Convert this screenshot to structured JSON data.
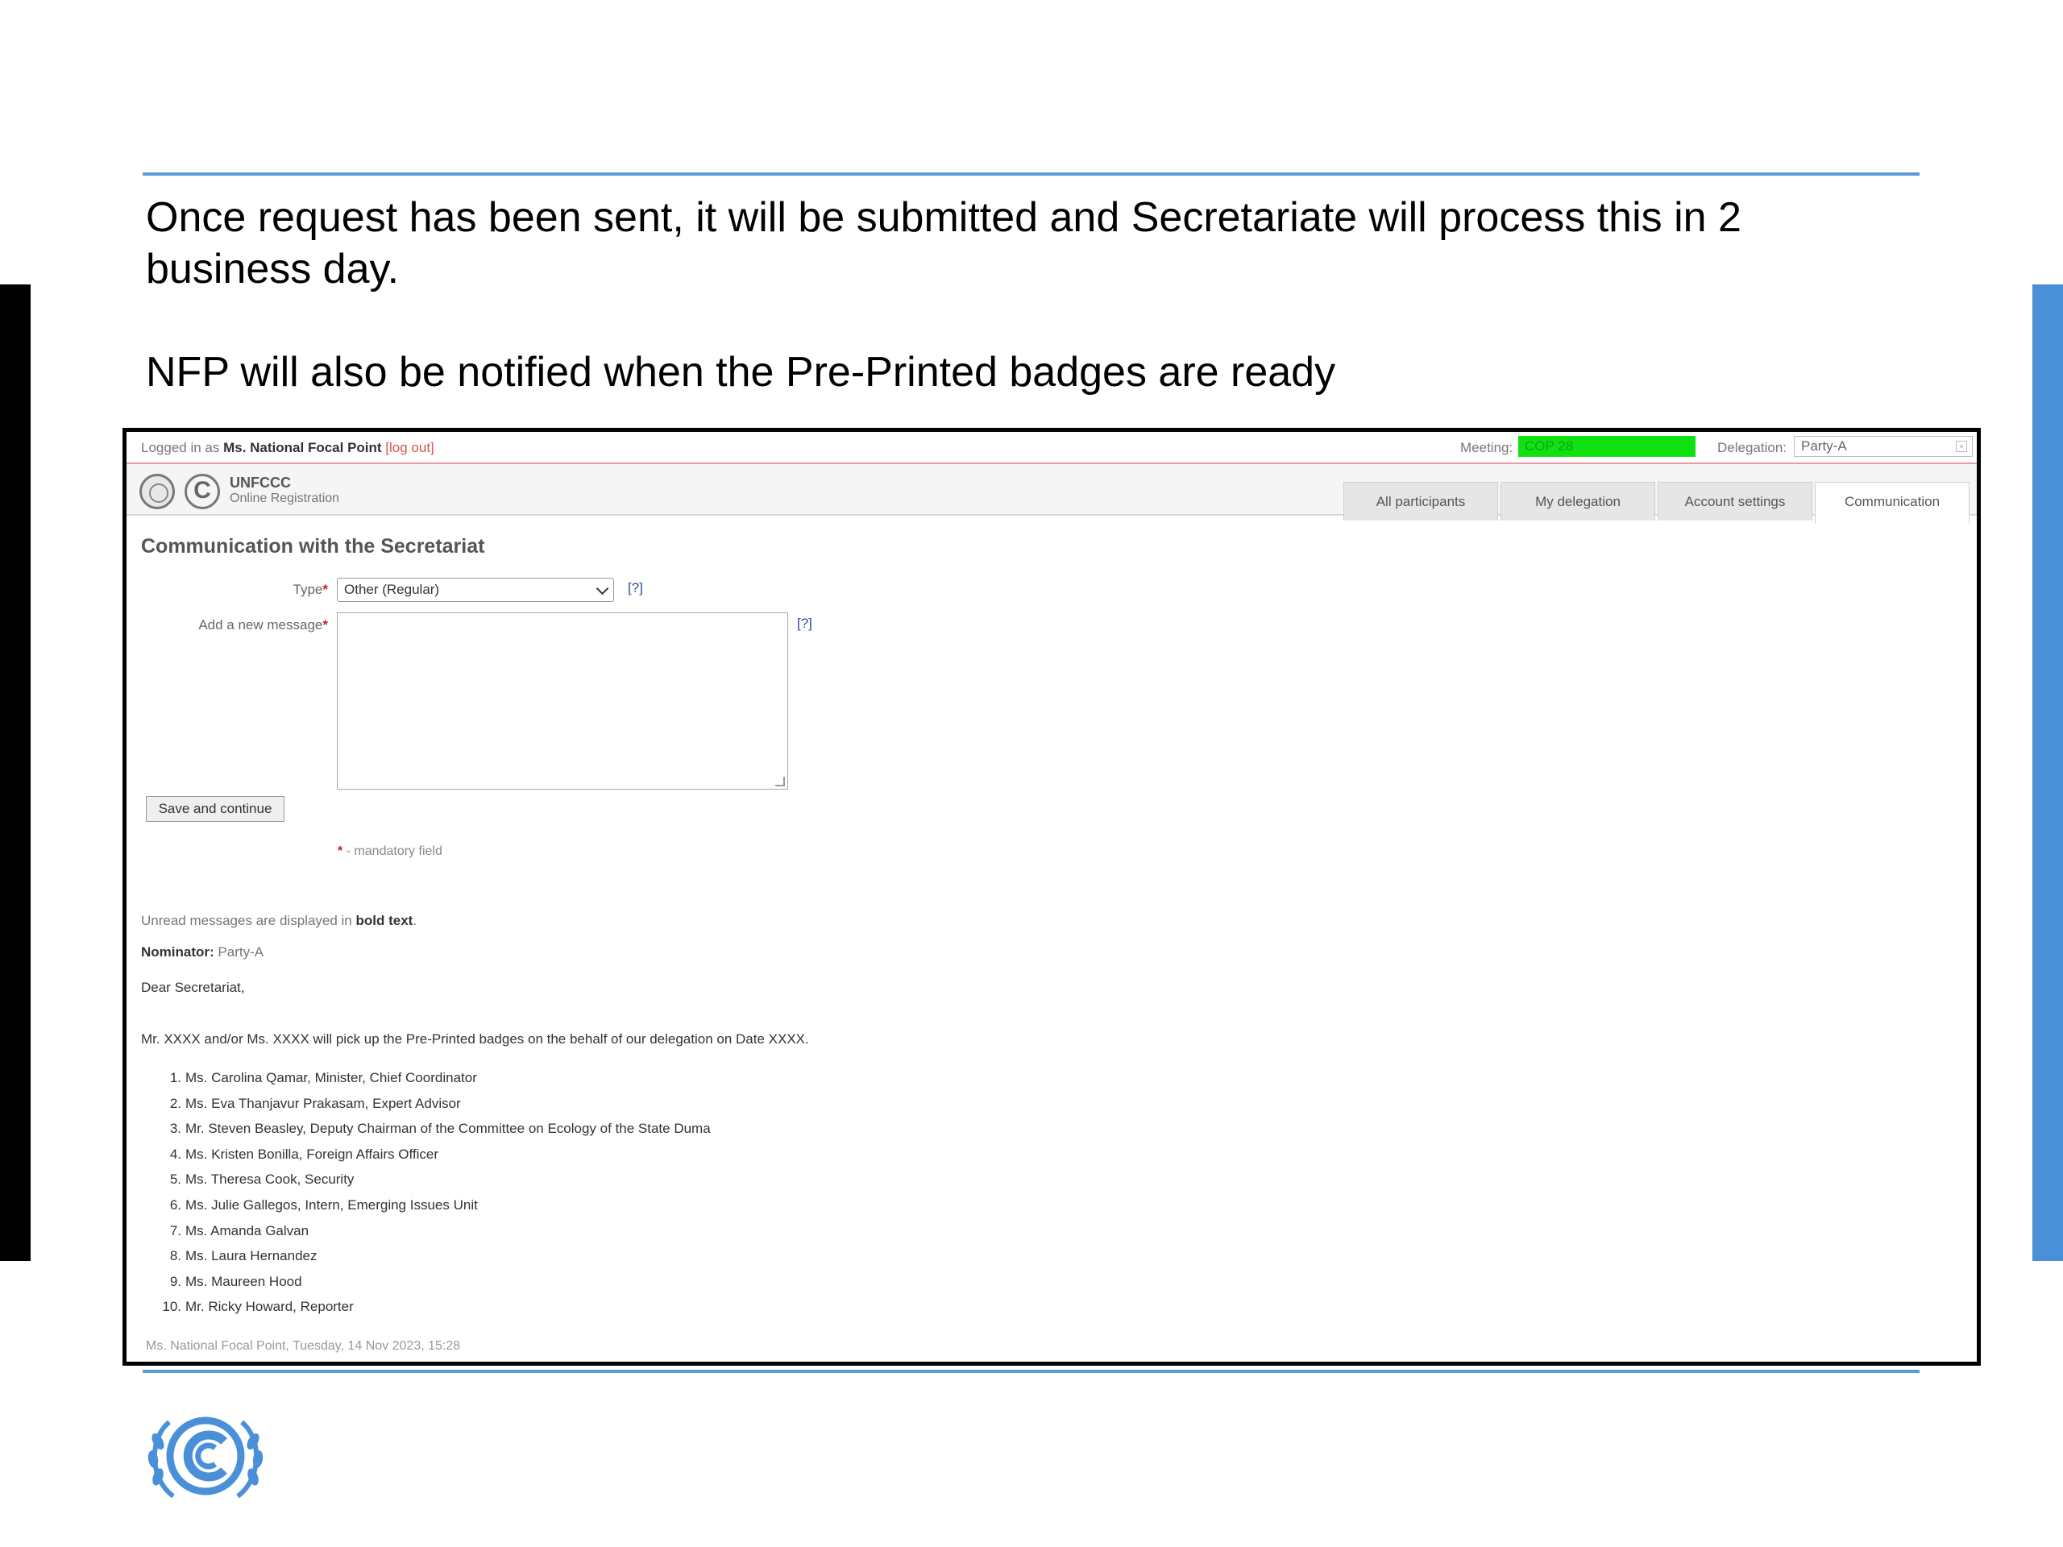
{
  "slide": {
    "paragraph1": "Once request has been sent, it will be submitted and Secretariate will process this in 2 business day.",
    "paragraph2": "NFP will also be notified when the Pre-Printed badges are ready"
  },
  "topbar": {
    "logged_in_prefix": "Logged in as ",
    "user_name": "Ms. National Focal Point",
    "logout_label": "[log out]",
    "meeting_label": "Meeting:",
    "meeting_value": "COP 28",
    "meeting_color": "#11e011",
    "delegation_label": "Delegation:",
    "delegation_value": "Party-A"
  },
  "header": {
    "brand": "UNFCCC",
    "brand_sub": "Online Registration",
    "tabs": [
      {
        "label": "All participants"
      },
      {
        "label": "My delegation"
      },
      {
        "label": "Account settings"
      },
      {
        "label": "Communication",
        "active": true
      }
    ]
  },
  "form": {
    "title": "Communication with the Secretariat",
    "type_label": "Type",
    "type_value": "Other (Regular)",
    "message_label": "Add a new message",
    "help_label": "[?]",
    "save_button": "Save and continue",
    "mandatory_note": " - mandatory field",
    "required_mark": "*"
  },
  "messages": {
    "unread_prefix": "Unread messages are displayed in ",
    "unread_bold": "bold text",
    "unread_suffix": ".",
    "nominator_label": "Nominator:",
    "nominator_value": " Party-A",
    "greeting": "Dear Secretariat,",
    "body": "Mr. XXXX and/or Ms. XXXX will pick up the Pre-Printed badges on the behalf of our delegation on Date XXXX.",
    "participants": [
      "Ms. Carolina Qamar, Minister, Chief Coordinator",
      "Ms. Eva Thanjavur Prakasam, Expert Advisor",
      "Mr. Steven Beasley, Deputy Chairman of the Committee on Ecology of the State Duma",
      "Ms. Kristen Bonilla, Foreign Affairs Officer",
      "Ms. Theresa Cook, Security",
      "Ms. Julie Gallegos, Intern, Emerging Issues Unit",
      "Ms. Amanda Galvan",
      "Ms. Laura Hernandez",
      "Ms. Maureen Hood",
      "Mr. Ricky Howard, Reporter"
    ],
    "signature": "Ms. National Focal Point, Tuesday, 14 Nov 2023, 15:28"
  },
  "colors": {
    "accent_blue": "#5b9bd5",
    "required_red": "#d02020"
  }
}
